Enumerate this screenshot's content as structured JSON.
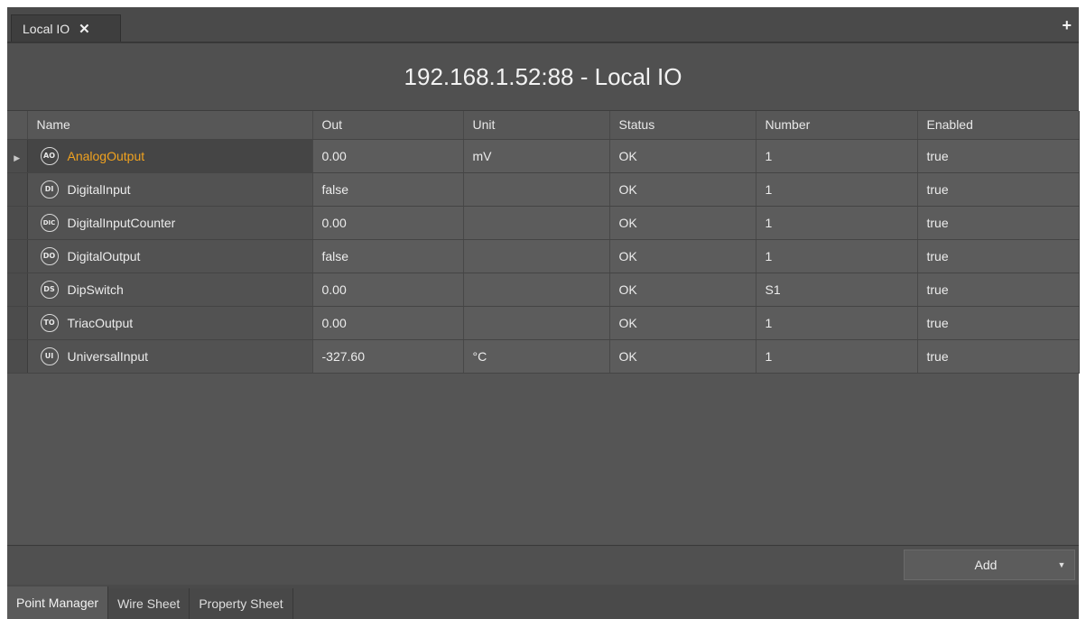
{
  "tab": {
    "label": "Local IO",
    "close": "✕"
  },
  "add_tab_icon": "+",
  "title": "192.168.1.52:88 - Local IO",
  "columns": [
    "Name",
    "Out",
    "Unit",
    "Status",
    "Number",
    "Enabled"
  ],
  "rows": [
    {
      "icon": "AO",
      "name": "AnalogOutput",
      "out": "0.00",
      "unit": "mV",
      "status": "OK",
      "number": "1",
      "enabled": "true"
    },
    {
      "icon": "DI",
      "name": "DigitalInput",
      "out": "false",
      "unit": "",
      "status": "OK",
      "number": "1",
      "enabled": "true"
    },
    {
      "icon": "DIC",
      "name": "DigitalInputCounter",
      "out": "0.00",
      "unit": "",
      "status": "OK",
      "number": "1",
      "enabled": "true"
    },
    {
      "icon": "DO",
      "name": "DigitalOutput",
      "out": "false",
      "unit": "",
      "status": "OK",
      "number": "1",
      "enabled": "true"
    },
    {
      "icon": "DS",
      "name": "DipSwitch",
      "out": "0.00",
      "unit": "",
      "status": "OK",
      "number": "S1",
      "enabled": "true"
    },
    {
      "icon": "TO",
      "name": "TriacOutput",
      "out": "0.00",
      "unit": "",
      "status": "OK",
      "number": "1",
      "enabled": "true"
    },
    {
      "icon": "UI",
      "name": "UniversalInput",
      "out": "-327.60",
      "unit": "°C",
      "status": "OK",
      "number": "1",
      "enabled": "true"
    }
  ],
  "add_button": {
    "label": "Add",
    "caret": "▼"
  },
  "view_tabs": [
    "Point Manager",
    "Wire Sheet",
    "Property Sheet"
  ],
  "colors": {
    "selected_text": "#f0a21f",
    "background": "#525252"
  }
}
